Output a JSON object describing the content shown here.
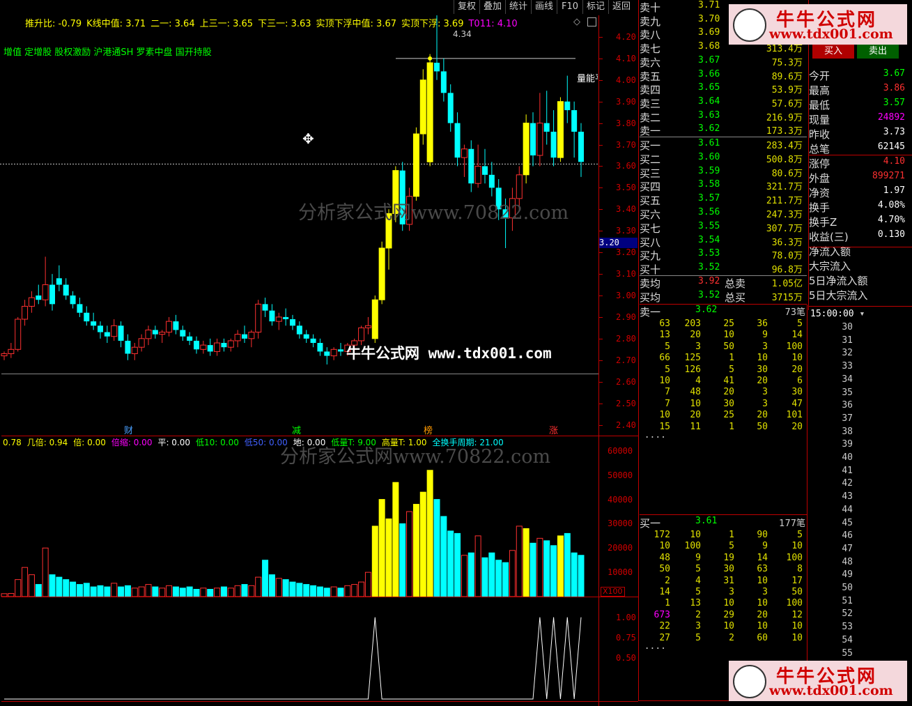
{
  "toolbar": {
    "buttons": [
      "复权",
      "叠加",
      "统计",
      "画线",
      "F10",
      "标记",
      "返回"
    ]
  },
  "indicator_line": {
    "items": [
      {
        "text": "推升比: -0.79",
        "color": "#ffff00"
      },
      {
        "text": "K线中值: 3.71",
        "color": "#ffff00"
      },
      {
        "text": "二一: 3.64",
        "color": "#ffff00"
      },
      {
        "text": "上三一: 3.65",
        "color": "#ffff00"
      },
      {
        "text": "下三一: 3.63",
        "color": "#ffff00"
      },
      {
        "text": "实顶下浮中值: 3.67",
        "color": "#ffff00"
      },
      {
        "text": "实顶下浮: 3.69",
        "color": "#ffff00"
      },
      {
        "text": "T011: 4.10",
        "color": "#ff00ff"
      }
    ]
  },
  "concepts_line": "增值 定增股 股权激励 沪港通SH 罗素中盘 国开持股",
  "price_chart": {
    "high_label": "4.34",
    "current_price_tag": "3.20",
    "level_label": "量能平",
    "y_ticks": [
      "4.20",
      "4.10",
      "4.00",
      "3.90",
      "3.80",
      "3.70",
      "3.60",
      "3.50",
      "3.40",
      "3.30",
      "3.20",
      "3.10",
      "3.00",
      "2.90",
      "2.80",
      "2.70",
      "2.60",
      "2.50",
      "2.40"
    ],
    "event_marks": [
      "财",
      "减",
      "榜",
      "涨"
    ]
  },
  "watermark_top": "分析家公式网www.70822.com",
  "watermark_mid": "牛牛公式网 www.tdx001.com",
  "watermark_bottom": "分析家公式网www.70822.com",
  "volume_indicator_line": {
    "items": [
      {
        "text": "0.78",
        "color": "#ffff00"
      },
      {
        "text": "几倍: 0.94",
        "color": "#ffff00"
      },
      {
        "text": "倍: 0.00",
        "color": "#ffff00"
      },
      {
        "text": "倍缩: 0.00",
        "color": "#ff00ff"
      },
      {
        "text": "平: 0.00",
        "color": "#ffffff"
      },
      {
        "text": "低10: 0.00",
        "color": "#00ff00"
      },
      {
        "text": "低50: 0.00",
        "color": "#4060ff"
      },
      {
        "text": "地: 0.00",
        "color": "#ffffff"
      },
      {
        "text": "低量T: 9.00",
        "color": "#00ff00"
      },
      {
        "text": "高量T: 1.00",
        "color": "#ffff00"
      },
      {
        "text": "全换手周期: 21.00",
        "color": "#00ffff"
      }
    ]
  },
  "volume_chart": {
    "y_ticks": [
      "60000",
      "50000",
      "40000",
      "30000",
      "20000",
      "10000"
    ],
    "unit": "X100"
  },
  "bottom_chart": {
    "y_ticks": [
      "1.00",
      "0.75",
      "0.50"
    ]
  },
  "order_book": {
    "asks": [
      {
        "name": "卖十",
        "price": "3.71",
        "vol": ""
      },
      {
        "name": "卖九",
        "price": "3.70",
        "vol": ""
      },
      {
        "name": "卖八",
        "price": "3.69",
        "vol": ""
      },
      {
        "name": "卖七",
        "price": "3.68",
        "vol": "313.4万"
      },
      {
        "name": "卖六",
        "price": "3.67",
        "vol": "75.3万"
      },
      {
        "name": "卖五",
        "price": "3.66",
        "vol": "89.6万"
      },
      {
        "name": "卖四",
        "price": "3.65",
        "vol": "53.9万"
      },
      {
        "name": "卖三",
        "price": "3.64",
        "vol": "57.6万"
      },
      {
        "name": "卖二",
        "price": "3.63",
        "vol": "216.9万"
      },
      {
        "name": "卖一",
        "price": "3.62",
        "vol": "173.3万"
      }
    ],
    "bids": [
      {
        "name": "买一",
        "price": "3.61",
        "vol": "283.4万"
      },
      {
        "name": "买二",
        "price": "3.60",
        "vol": "500.8万"
      },
      {
        "name": "买三",
        "price": "3.59",
        "vol": "80.6万"
      },
      {
        "name": "买四",
        "price": "3.58",
        "vol": "321.7万"
      },
      {
        "name": "买五",
        "price": "3.57",
        "vol": "211.7万"
      },
      {
        "name": "买六",
        "price": "3.56",
        "vol": "247.3万"
      },
      {
        "name": "买七",
        "price": "3.55",
        "vol": "307.7万"
      },
      {
        "name": "买八",
        "price": "3.54",
        "vol": "36.3万"
      },
      {
        "name": "买九",
        "price": "3.53",
        "vol": "78.0万"
      },
      {
        "name": "买十",
        "price": "3.52",
        "vol": "96.8万"
      }
    ],
    "avg": [
      {
        "name": "卖均",
        "price": "3.92",
        "label": "总卖",
        "vol": "1.05亿"
      },
      {
        "name": "买均",
        "price": "3.52",
        "label": "总买",
        "vol": "3715万"
      }
    ]
  },
  "trade_buttons": {
    "buy": "买入",
    "sell": "卖出"
  },
  "stock_info": [
    {
      "k": "今开",
      "v": "3.67",
      "color": "#00ff00"
    },
    {
      "k": "最高",
      "v": "3.86",
      "color": "#ff3030"
    },
    {
      "k": "最低",
      "v": "3.57",
      "color": "#00ff00"
    },
    {
      "k": "现量",
      "v": "24892",
      "color": "#ff00ff"
    },
    {
      "k": "昨收",
      "v": "3.73",
      "color": "#ffffff"
    },
    {
      "k": "总笔",
      "v": "62145",
      "color": "#ffffff"
    },
    {
      "k": "涨停",
      "v": "4.10",
      "color": "#ff3030"
    },
    {
      "k": "外盘",
      "v": "899271",
      "color": "#ff3030"
    },
    {
      "k": "净资",
      "v": "1.97",
      "color": "#ffffff"
    },
    {
      "k": "换手",
      "v": "4.08%",
      "color": "#ffffff"
    },
    {
      "k": "换手Z",
      "v": "4.70%",
      "color": "#ffffff"
    },
    {
      "k": "收益(三)",
      "v": "0.130",
      "color": "#ffffff"
    },
    {
      "k": "净流入额",
      "v": "",
      "color": "#ffffff"
    },
    {
      "k": "大宗流入",
      "v": "",
      "color": "#ffffff"
    },
    {
      "k": "5日净流入额",
      "v": "",
      "color": "#ffffff"
    },
    {
      "k": "5日大宗流入",
      "v": "",
      "color": "#ffffff"
    }
  ],
  "sell_queue": {
    "header_name": "卖一",
    "header_price": "3.62",
    "header_count": "73笔",
    "rows": [
      [
        "63",
        "203",
        "25",
        "36",
        "5"
      ],
      [
        "13",
        "20",
        "10",
        "9",
        "14"
      ],
      [
        "5",
        "3",
        "50",
        "3",
        "100"
      ],
      [
        "66",
        "125",
        "1",
        "10",
        "10"
      ],
      [
        "5",
        "126",
        "5",
        "30",
        "20"
      ],
      [
        "10",
        "4",
        "41",
        "20",
        "6"
      ],
      [
        "7",
        "48",
        "20",
        "3",
        "30"
      ],
      [
        "7",
        "10",
        "30",
        "3",
        "47"
      ],
      [
        "10",
        "20",
        "25",
        "20",
        "101"
      ],
      [
        "15",
        "11",
        "1",
        "50",
        "20"
      ]
    ],
    "more": "...."
  },
  "buy_queue": {
    "header_name": "买一",
    "header_price": "3.61",
    "header_count": "177笔",
    "rows": [
      [
        "172",
        "10",
        "1",
        "90",
        "5"
      ],
      [
        "10",
        "100",
        "5",
        "9",
        "10"
      ],
      [
        "48",
        "9",
        "19",
        "14",
        "100"
      ],
      [
        "50",
        "5",
        "30",
        "63",
        "8"
      ],
      [
        "2",
        "4",
        "31",
        "10",
        "17"
      ],
      [
        "14",
        "5",
        "3",
        "3",
        "50"
      ],
      [
        "1",
        "13",
        "10",
        "10",
        "100"
      ],
      [
        "673",
        "2",
        "29",
        "20",
        "12"
      ],
      [
        "22",
        "3",
        "10",
        "10",
        "10"
      ],
      [
        "27",
        "5",
        "2",
        "60",
        "10"
      ]
    ],
    "more": "...."
  },
  "minute_list": {
    "time": "15:00:00",
    "minutes": [
      "30",
      "31",
      "32",
      "33",
      "34",
      "35",
      "36",
      "37",
      "38",
      "39",
      "40",
      "41",
      "42",
      "43",
      "44",
      "45",
      "46",
      "47",
      "48",
      "49",
      "50",
      "51",
      "52",
      "53",
      "54",
      "55"
    ]
  },
  "banner": {
    "name": "牛牛公式网",
    "url": "www.tdx001.com"
  },
  "chart_data": {
    "type": "candlestick",
    "ylim": [
      2.35,
      4.3
    ],
    "candles": [
      [
        2.72,
        2.74,
        2.7,
        2.73
      ],
      [
        2.73,
        2.78,
        2.71,
        2.75
      ],
      [
        2.75,
        2.9,
        2.74,
        2.89
      ],
      [
        2.89,
        2.98,
        2.86,
        2.95
      ],
      [
        2.95,
        3.02,
        2.92,
        2.99
      ],
      [
        3.0,
        3.05,
        2.96,
        2.98
      ],
      [
        2.98,
        3.18,
        2.95,
        3.05
      ],
      [
        3.05,
        3.1,
        2.93,
        2.96
      ],
      [
        3.08,
        3.14,
        3.02,
        3.05
      ],
      [
        3.05,
        3.08,
        2.98,
        3.0
      ],
      [
        3.0,
        3.02,
        2.94,
        2.96
      ],
      [
        2.96,
        2.99,
        2.9,
        2.92
      ],
      [
        2.92,
        2.95,
        2.86,
        2.88
      ],
      [
        2.88,
        2.92,
        2.84,
        2.86
      ],
      [
        2.86,
        2.88,
        2.8,
        2.83
      ],
      [
        2.83,
        2.86,
        2.78,
        2.81
      ],
      [
        2.81,
        2.89,
        2.79,
        2.86
      ],
      [
        2.86,
        2.88,
        2.76,
        2.79
      ],
      [
        2.79,
        2.82,
        2.7,
        2.73
      ],
      [
        2.73,
        2.78,
        2.7,
        2.76
      ],
      [
        2.76,
        2.82,
        2.74,
        2.8
      ],
      [
        2.8,
        2.86,
        2.77,
        2.84
      ],
      [
        2.84,
        2.86,
        2.8,
        2.82
      ],
      [
        2.82,
        2.84,
        2.78,
        2.83
      ],
      [
        2.83,
        2.9,
        2.81,
        2.88
      ],
      [
        2.88,
        2.91,
        2.82,
        2.84
      ],
      [
        2.84,
        2.86,
        2.79,
        2.81
      ],
      [
        2.81,
        2.83,
        2.77,
        2.79
      ],
      [
        2.79,
        2.81,
        2.73,
        2.75
      ],
      [
        2.75,
        2.79,
        2.73,
        2.77
      ],
      [
        2.77,
        2.8,
        2.72,
        2.74
      ],
      [
        2.74,
        2.8,
        2.72,
        2.78
      ],
      [
        2.78,
        2.8,
        2.74,
        2.76
      ],
      [
        2.76,
        2.8,
        2.74,
        2.79
      ],
      [
        2.79,
        2.84,
        2.76,
        2.82
      ],
      [
        2.82,
        2.86,
        2.78,
        2.8
      ],
      [
        2.8,
        2.84,
        2.76,
        2.83
      ],
      [
        2.83,
        2.98,
        2.8,
        2.96
      ],
      [
        2.96,
        2.99,
        2.9,
        2.93
      ],
      [
        2.93,
        2.96,
        2.86,
        2.88
      ],
      [
        2.88,
        2.92,
        2.84,
        2.9
      ],
      [
        2.9,
        2.94,
        2.86,
        2.89
      ],
      [
        2.89,
        2.91,
        2.84,
        2.86
      ],
      [
        2.86,
        2.88,
        2.8,
        2.82
      ],
      [
        2.82,
        2.84,
        2.78,
        2.8
      ],
      [
        2.8,
        2.82,
        2.76,
        2.78
      ],
      [
        2.78,
        2.8,
        2.72,
        2.74
      ],
      [
        2.74,
        2.76,
        2.68,
        2.72
      ],
      [
        2.72,
        2.76,
        2.7,
        2.75
      ],
      [
        2.75,
        2.78,
        2.72,
        2.74
      ],
      [
        2.74,
        2.78,
        2.72,
        2.77
      ],
      [
        2.77,
        2.8,
        2.74,
        2.79
      ],
      [
        2.79,
        2.86,
        2.77,
        2.85
      ],
      [
        2.85,
        2.9,
        2.82,
        2.86
      ],
      [
        2.8,
        3.0,
        2.78,
        2.98
      ],
      [
        2.98,
        3.25,
        2.96,
        3.22
      ],
      [
        3.22,
        3.4,
        3.12,
        3.38
      ],
      [
        3.38,
        3.6,
        3.34,
        3.58
      ],
      [
        3.58,
        3.62,
        3.3,
        3.33
      ],
      [
        3.33,
        3.5,
        3.3,
        3.46
      ],
      [
        3.46,
        3.78,
        3.44,
        3.75
      ],
      [
        3.75,
        4.05,
        3.7,
        4.0
      ],
      [
        3.62,
        4.12,
        3.6,
        4.08
      ],
      [
        4.08,
        4.34,
        4.0,
        4.04
      ],
      [
        4.04,
        4.1,
        3.9,
        3.94
      ],
      [
        3.94,
        3.98,
        3.76,
        3.8
      ],
      [
        3.8,
        3.85,
        3.6,
        3.64
      ],
      [
        3.64,
        3.7,
        3.55,
        3.68
      ],
      [
        3.68,
        3.72,
        3.48,
        3.52
      ],
      [
        3.52,
        3.7,
        3.5,
        3.6
      ],
      [
        3.6,
        3.68,
        3.52,
        3.56
      ],
      [
        3.56,
        3.62,
        3.46,
        3.5
      ],
      [
        3.5,
        3.54,
        3.35,
        3.4
      ],
      [
        3.4,
        3.45,
        3.22,
        3.36
      ],
      [
        3.36,
        3.5,
        3.3,
        3.45
      ],
      [
        3.45,
        3.6,
        3.4,
        3.56
      ],
      [
        3.56,
        3.84,
        3.52,
        3.8
      ],
      [
        3.8,
        3.85,
        3.6,
        3.65
      ],
      [
        3.65,
        3.94,
        3.6,
        3.8
      ],
      [
        3.8,
        3.95,
        3.7,
        3.76
      ],
      [
        3.76,
        3.86,
        3.6,
        3.64
      ],
      [
        3.64,
        3.92,
        3.62,
        3.9
      ],
      [
        3.9,
        4.02,
        3.8,
        3.86
      ],
      [
        3.86,
        3.9,
        3.64,
        3.76
      ],
      [
        3.76,
        3.8,
        3.55,
        3.62
      ]
    ],
    "volume": [
      1200,
      1300,
      7000,
      12000,
      9000,
      5000,
      20000,
      9000,
      8000,
      7000,
      6000,
      5000,
      5500,
      4000,
      4500,
      4000,
      5500,
      4000,
      4500,
      3500,
      4000,
      5000,
      4000,
      3500,
      4500,
      4000,
      3500,
      4000,
      3000,
      3500,
      3000,
      3500,
      4000,
      3500,
      4500,
      5000,
      4500,
      8000,
      15000,
      9000,
      7500,
      7000,
      6000,
      5500,
      5000,
      4500,
      4000,
      3500,
      4000,
      3500,
      4500,
      5000,
      6000,
      10000,
      29000,
      40000,
      32000,
      47000,
      30000,
      35000,
      38000,
      43000,
      52000,
      40000,
      33000,
      27000,
      26000,
      17000,
      18000,
      25000,
      16000,
      18000,
      15000,
      14000,
      19000,
      29000,
      28000,
      22000,
      24000,
      23000,
      21000,
      25000,
      26000,
      18000,
      17000
    ],
    "signal_peaks": [
      54,
      78,
      80,
      82,
      84
    ]
  }
}
